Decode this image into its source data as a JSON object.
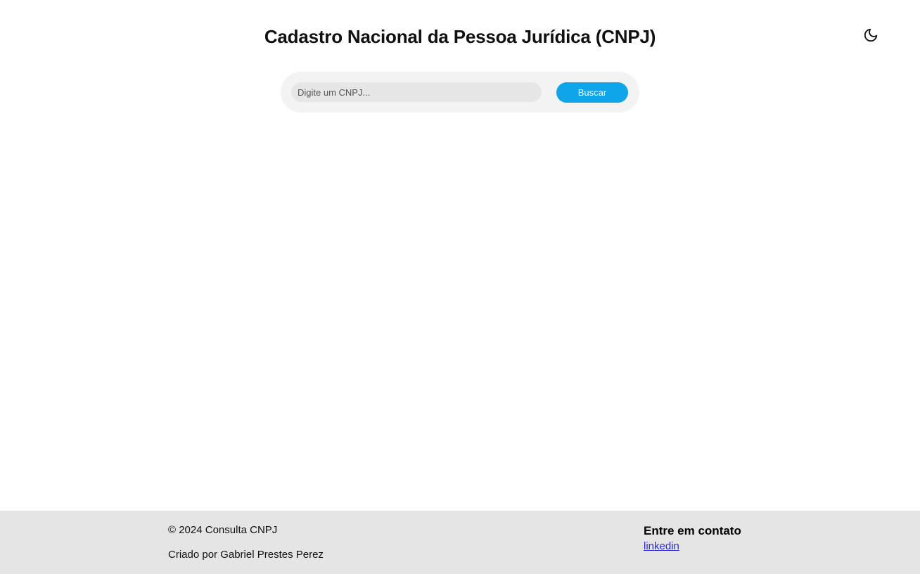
{
  "header": {
    "title": "Cadastro Nacional da Pessoa Jurídica (CNPJ)",
    "theme_toggle_icon": "moon-icon"
  },
  "search": {
    "value": "",
    "placeholder": "Digite um CNPJ...",
    "button_label": "Buscar",
    "button_color": "#0ea5e9"
  },
  "footer": {
    "copyright": "© 2024 Consulta CNPJ",
    "credits": "Criado por Gabriel Prestes Perez",
    "contact_heading": "Entre em contato",
    "contact_link_label": "linkedin",
    "background_color": "#e5e5e5"
  }
}
